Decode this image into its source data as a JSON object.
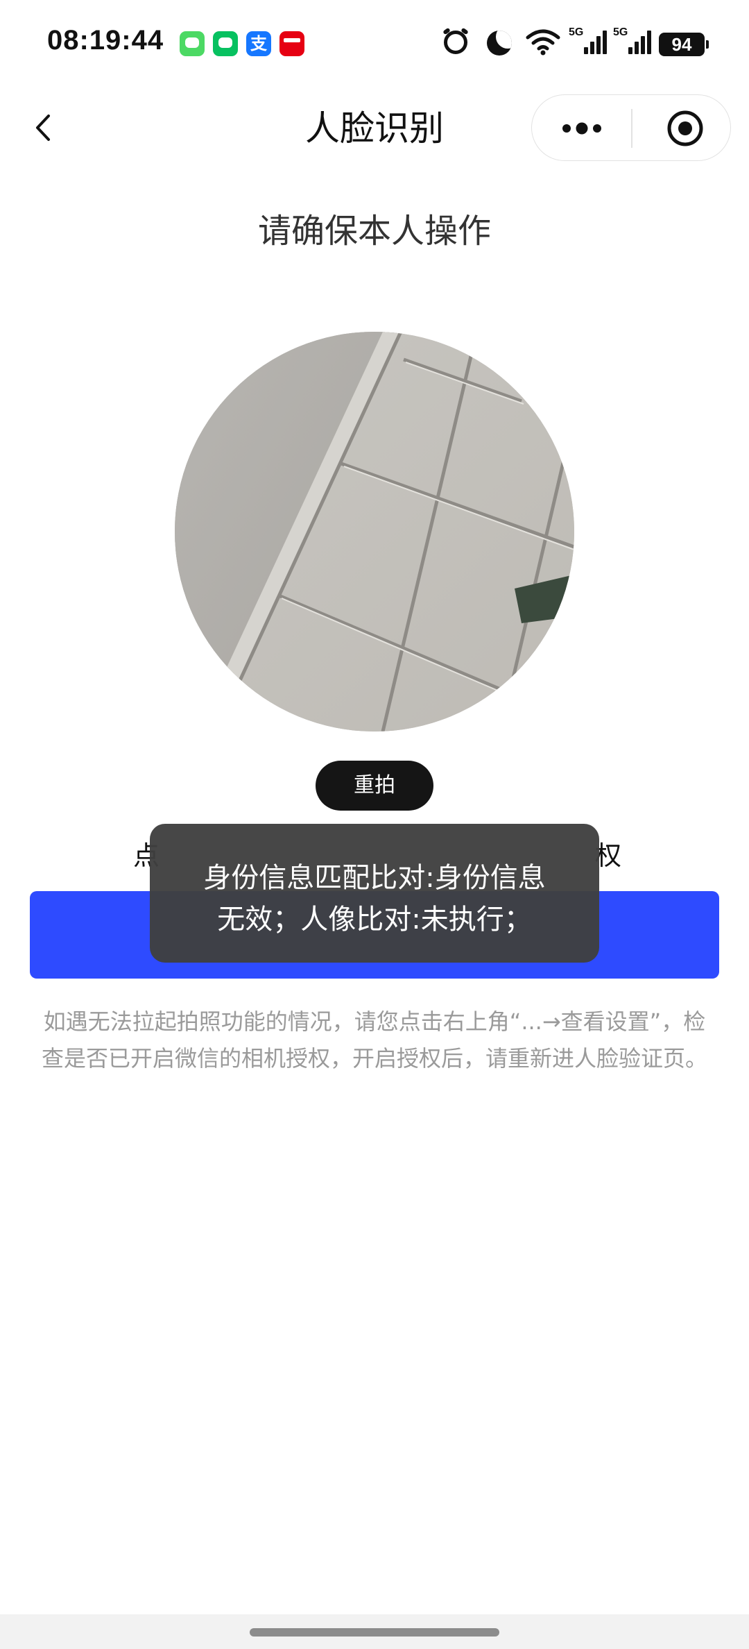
{
  "status_bar": {
    "time": "08:19:44",
    "notification_icons": [
      "messages-icon",
      "wechat-icon",
      "alipay-icon",
      "cloudpay-icon"
    ],
    "alipay_glyph": "支",
    "network_label": "5G",
    "battery_level": "94"
  },
  "nav": {
    "title": "人脸识别",
    "icons": {
      "back": "chevron-left-icon",
      "more": "more-dots-icon",
      "close": "target-circle-icon"
    }
  },
  "main": {
    "prompt": "请确保本人操作",
    "retake_label": "重拍",
    "consent_line_left": "点",
    "consent_line_right": "权",
    "primary_button_label": "",
    "help_text": "如遇无法拉起拍照功能的情况，请您点击右上角“...→查看设置”，检查是否已开启微信的相机授权，开启授权后，请重新进人脸验证页。"
  },
  "toast": {
    "line1": "身份信息匹配比对:身份信息",
    "line2": "无效；人像比对:未执行；"
  },
  "colors": {
    "primary_button": "#2e4bff",
    "toast_bg": "#404040",
    "retake_button": "#151515",
    "help_text": "#9a9a9a"
  }
}
